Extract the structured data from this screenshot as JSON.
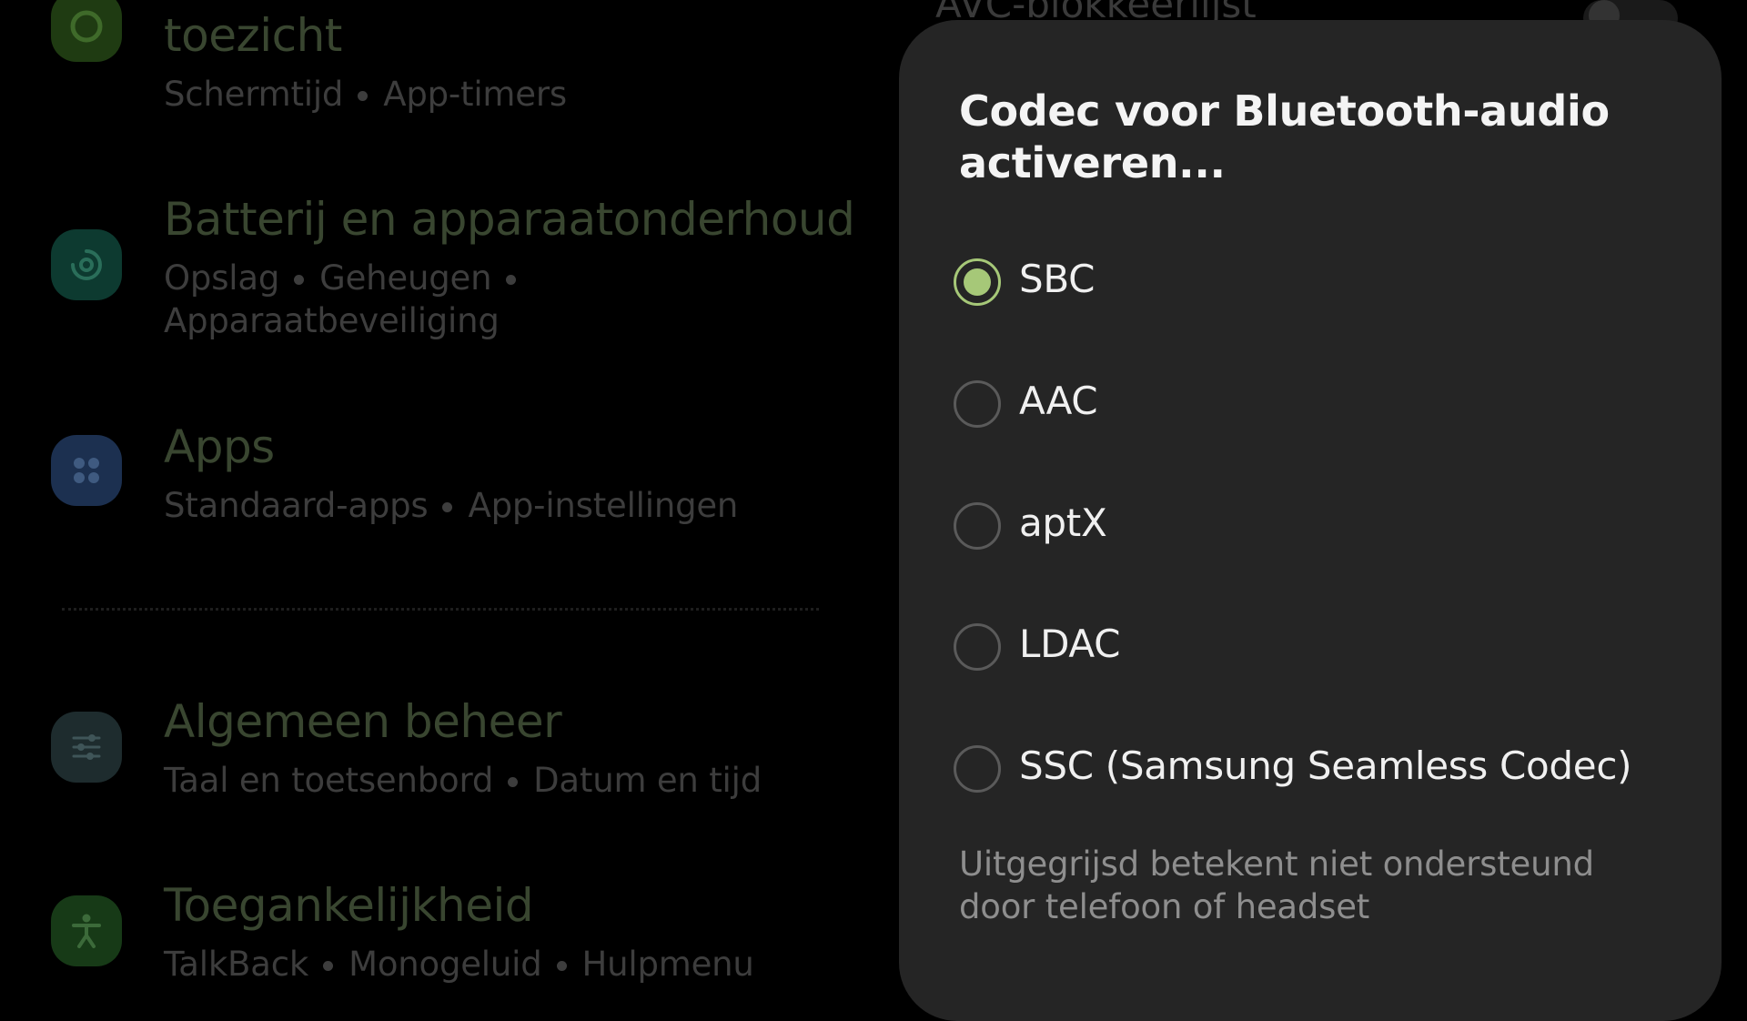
{
  "background_settings": {
    "top_right_title": "AVC-blokkeerlijst",
    "items": [
      {
        "title": "toezicht",
        "subtitle_parts": [
          "Schermtijd",
          "App-timers"
        ],
        "icon": "digital-wellbeing-icon",
        "color": "#1f3b12"
      },
      {
        "title": "Batterij en apparaatonderhoud",
        "subtitle_parts": [
          "Opslag",
          "Geheugen",
          "Apparaatbeveiliging"
        ],
        "icon": "device-care-icon",
        "color": "#0d3a30"
      },
      {
        "title": "Apps",
        "subtitle_parts": [
          "Standaard-apps",
          "App-instellingen"
        ],
        "icon": "apps-grid-icon",
        "color": "#1c3050"
      },
      {
        "title": "Algemeen beheer",
        "subtitle_parts": [
          "Taal en toetsenbord",
          "Datum en tijd"
        ],
        "icon": "sliders-icon",
        "color": "#1e2c2e"
      },
      {
        "title": "Toegankelijkheid",
        "subtitle_parts": [
          "TalkBack",
          "Monogeluid",
          "Hulpmenu"
        ],
        "icon": "accessibility-icon",
        "color": "#173a17"
      }
    ]
  },
  "dialog": {
    "title": "Codec voor Bluetooth-audio activeren...",
    "options": [
      {
        "label": "SBC",
        "selected": true
      },
      {
        "label": "AAC",
        "selected": false
      },
      {
        "label": "aptX",
        "selected": false
      },
      {
        "label": "LDAC",
        "selected": false
      },
      {
        "label": "SSC (Samsung Seamless Codec)",
        "selected": false
      }
    ],
    "note": "Uitgegrijsd betekent niet ondersteund door telefoon of headset",
    "accent_color": "#a6c878"
  }
}
